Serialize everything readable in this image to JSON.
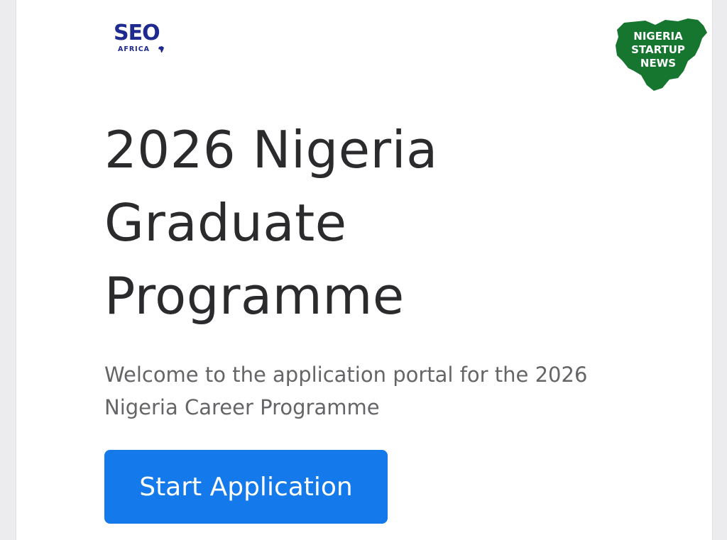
{
  "logos": {
    "seo": {
      "main": "SEO",
      "sub": "AFRICA",
      "color": "#1e2a8f"
    },
    "nigeria_startup_news": {
      "lines": [
        "NIGERIA",
        "STARTUP",
        "NEWS"
      ],
      "color": "#16752e"
    }
  },
  "hero": {
    "title_lines": [
      "2026 Nigeria",
      "Graduate",
      "Programme"
    ],
    "welcome_text": "Welcome to the application portal for the 2026 Nigeria Career Programme"
  },
  "actions": {
    "start_label": "Start Application",
    "start_color": "#1479ea"
  }
}
